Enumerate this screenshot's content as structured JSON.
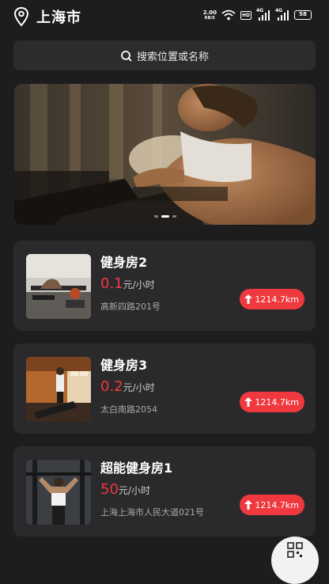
{
  "status_bar": {
    "city": "上海市",
    "net_speed_value": "2.00",
    "net_speed_unit": "KB/S",
    "hd_badge": "HD",
    "signal_1_label": "4G",
    "signal_2_label": "4G",
    "battery": "58"
  },
  "search": {
    "placeholder": "搜索位置或名称"
  },
  "banner": {
    "slides": 3,
    "active_slide": 1
  },
  "gyms": [
    {
      "name": "健身房2",
      "price": "0.1",
      "unit": "元/小时",
      "address": "高新四路201号",
      "distance": "1214.7km"
    },
    {
      "name": "健身房3",
      "price": "0.2",
      "unit": "元/小时",
      "address": "太白南路2054",
      "distance": "1214.7km"
    },
    {
      "name": "超能健身房1",
      "price": "50",
      "unit": "元/小时",
      "address": "上海上海市人民大道021号",
      "distance": "1214.7km"
    }
  ],
  "colors": {
    "accent": "#f0393e",
    "background": "#1d1d1f",
    "card": "#2a2a2c"
  },
  "icons": {
    "location": "location-pin-icon",
    "search": "search-icon",
    "distance": "navigation-arrow-icon",
    "scan": "qr-scan-icon"
  }
}
